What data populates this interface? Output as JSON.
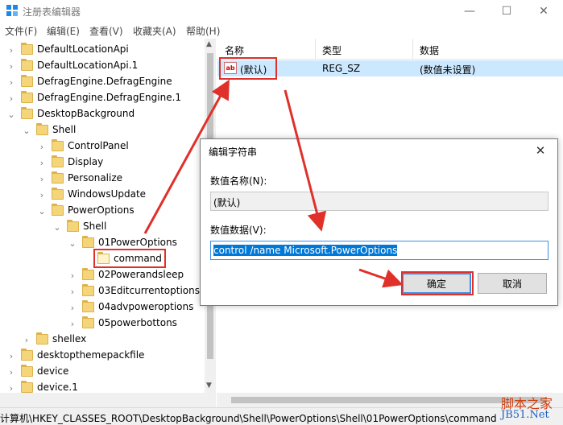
{
  "window": {
    "title": "注册表编辑器"
  },
  "menu": [
    "文件(F)",
    "编辑(E)",
    "查看(V)",
    "收藏夹(A)",
    "帮助(H)"
  ],
  "tree": [
    {
      "label": "DefaultLocationApi",
      "depth": 0,
      "expander": "right"
    },
    {
      "label": "DefaultLocationApi.1",
      "depth": 0,
      "expander": "right"
    },
    {
      "label": "DefragEngine.DefragEngine",
      "depth": 0,
      "expander": "right"
    },
    {
      "label": "DefragEngine.DefragEngine.1",
      "depth": 0,
      "expander": "right"
    },
    {
      "label": "DesktopBackground",
      "depth": 0,
      "expander": "down"
    },
    {
      "label": "Shell",
      "depth": 1,
      "expander": "down"
    },
    {
      "label": "ControlPanel",
      "depth": 2,
      "expander": "right"
    },
    {
      "label": "Display",
      "depth": 2,
      "expander": "right"
    },
    {
      "label": "Personalize",
      "depth": 2,
      "expander": "right"
    },
    {
      "label": "WindowsUpdate",
      "depth": 2,
      "expander": "right"
    },
    {
      "label": "PowerOptions",
      "depth": 2,
      "expander": "down"
    },
    {
      "label": "Shell",
      "depth": 3,
      "expander": "down"
    },
    {
      "label": "01PowerOptions",
      "depth": 4,
      "expander": "down"
    },
    {
      "label": "command",
      "depth": 5,
      "expander": "none",
      "selected": true
    },
    {
      "label": "02Powerandsleep",
      "depth": 4,
      "expander": "right"
    },
    {
      "label": "03Editcurrentoptions",
      "depth": 4,
      "expander": "right"
    },
    {
      "label": "04advpoweroptions",
      "depth": 4,
      "expander": "right"
    },
    {
      "label": "05powerbottons",
      "depth": 4,
      "expander": "right"
    },
    {
      "label": "shellex",
      "depth": 1,
      "expander": "right"
    },
    {
      "label": "desktopthemepackfile",
      "depth": 0,
      "expander": "right"
    },
    {
      "label": "device",
      "depth": 0,
      "expander": "right"
    },
    {
      "label": "device.1",
      "depth": 0,
      "expander": "right"
    }
  ],
  "list": {
    "headers": [
      "名称",
      "类型",
      "数据"
    ],
    "rows": [
      {
        "name": "(默认)",
        "type": "REG_SZ",
        "data": "(数值未设置)"
      }
    ]
  },
  "status_path": "计算机\\HKEY_CLASSES_ROOT\\DesktopBackground\\Shell\\PowerOptions\\Shell\\01PowerOptions\\command",
  "dialog": {
    "title": "编辑字符串",
    "name_label": "数值名称(N):",
    "name_value": "(默认)",
    "data_label": "数值数据(V):",
    "data_value": "control /name Microsoft.PowerOptions",
    "ok": "确定",
    "cancel": "取消"
  },
  "watermark": {
    "line1": "脚本之家",
    "line2": "JB51.Net"
  },
  "colors": {
    "selection": "#cce8ff",
    "annotation": "#e0302a",
    "accent": "#0078d7",
    "folder": "#f5d57a"
  }
}
